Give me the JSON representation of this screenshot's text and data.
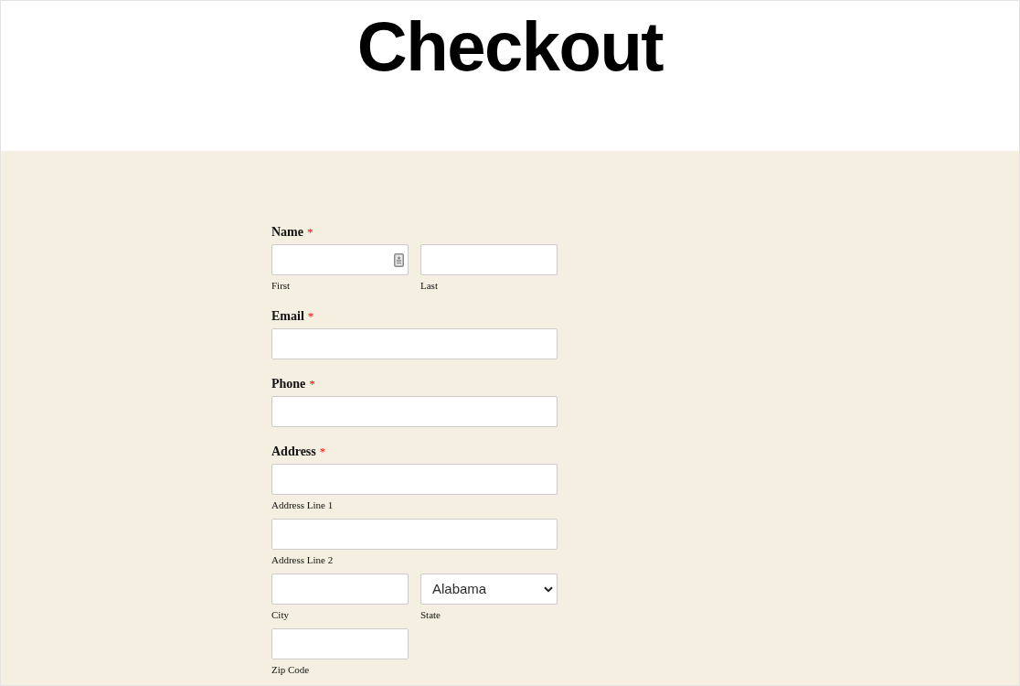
{
  "header": {
    "title": "Checkout"
  },
  "form": {
    "fields": [
      {
        "label": "Name",
        "required_mark": "*",
        "rows": [
          {
            "kind": "pair",
            "inputs": [
              {
                "kind": "text",
                "sublabel": "First",
                "autofill_icon": true
              },
              {
                "kind": "text",
                "sublabel": "Last"
              }
            ]
          }
        ]
      },
      {
        "label": "Email",
        "required_mark": "*",
        "rows": [
          {
            "kind": "wide",
            "inputs": [
              {
                "kind": "text"
              }
            ]
          }
        ]
      },
      {
        "label": "Phone",
        "required_mark": "*",
        "rows": [
          {
            "kind": "wide",
            "inputs": [
              {
                "kind": "text"
              }
            ]
          }
        ]
      },
      {
        "label": "Address",
        "required_mark": "*",
        "rows": [
          {
            "kind": "wide",
            "inputs": [
              {
                "kind": "text",
                "sublabel": "Address Line 1"
              }
            ]
          },
          {
            "kind": "wide",
            "inputs": [
              {
                "kind": "text",
                "sublabel": "Address Line 2"
              }
            ]
          },
          {
            "kind": "pair",
            "inputs": [
              {
                "kind": "text",
                "sublabel": "City"
              },
              {
                "kind": "select",
                "value": "Alabama",
                "sublabel": "State"
              }
            ]
          },
          {
            "kind": "pair",
            "inputs": [
              {
                "kind": "text",
                "sublabel": "Zip Code"
              }
            ]
          }
        ]
      }
    ]
  }
}
